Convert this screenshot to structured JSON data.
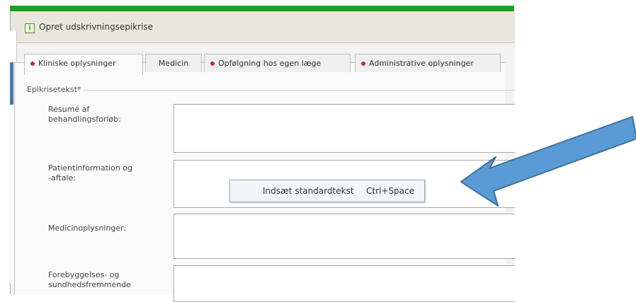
{
  "window": {
    "title": "Opret udskrivningsepikrise",
    "title_icon": "form-icon"
  },
  "tabs": [
    {
      "label": "Kliniske oplysninger",
      "has_dot": true,
      "active": true
    },
    {
      "label": "Medicin",
      "has_dot": false,
      "active": false
    },
    {
      "label": "Opfølgning hos egen læge",
      "has_dot": true,
      "active": false
    },
    {
      "label": "Administrative oplysninger",
      "has_dot": true,
      "active": false
    }
  ],
  "group": {
    "label": "Epikrisetekst*"
  },
  "fields": [
    {
      "label_line1": "Resumé af",
      "label_line2": "behandlingsforløb:"
    },
    {
      "label_line1": "Patientinformation og",
      "label_line2": "-aftale:"
    },
    {
      "label_line1": "Medicinoplysninger:",
      "label_line2": ""
    },
    {
      "label_line1": "Forebyggelses- og",
      "label_line2": "sundhedsfremmende"
    }
  ],
  "context_menu": {
    "item_label": "Indsæt standardtekst",
    "item_shortcut": "Ctrl+Space"
  },
  "colors": {
    "green_bar": "#1fa01f",
    "arrow_fill": "#5b9bd5",
    "arrow_stroke": "#41719c",
    "required_dot": "#c22b2b"
  }
}
